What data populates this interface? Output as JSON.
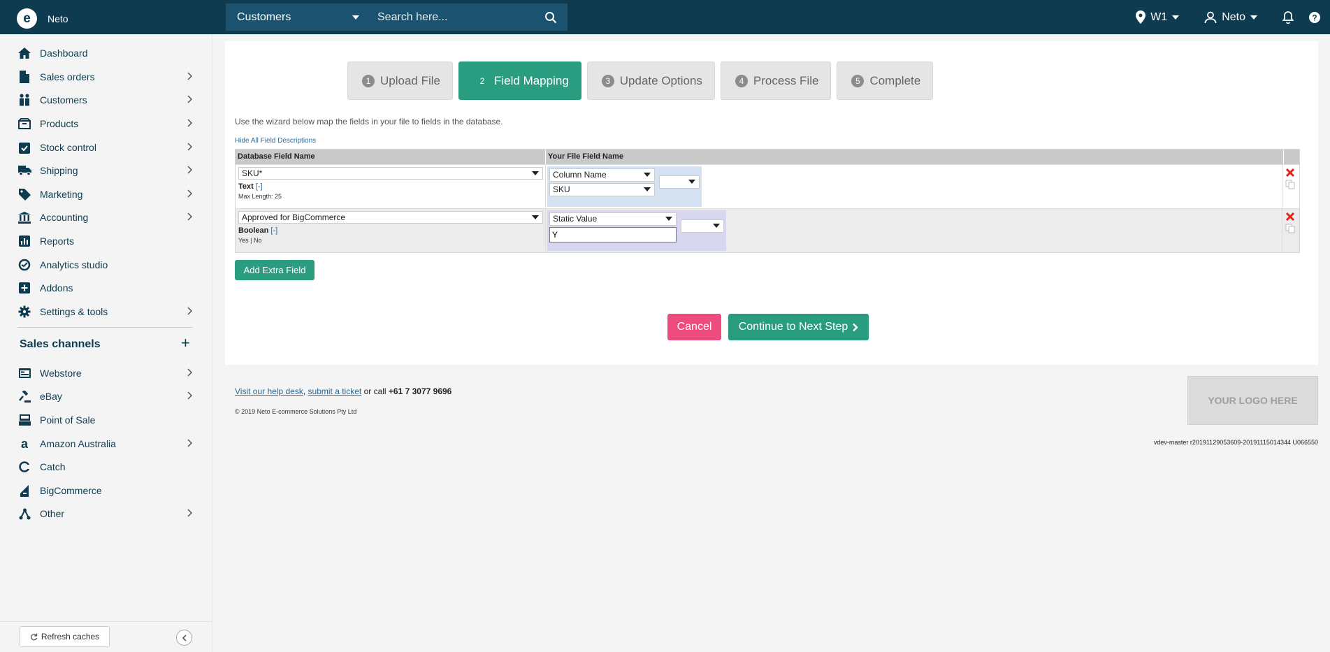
{
  "topbar": {
    "brand_logo": "e",
    "brand_name": "Neto",
    "search_scope": "Customers",
    "search_placeholder": "Search here...",
    "location": "W1",
    "user": "Neto"
  },
  "sidebar": {
    "items": [
      {
        "label": "Dashboard",
        "icon": "home-icon"
      },
      {
        "label": "Sales orders",
        "icon": "file-icon"
      },
      {
        "label": "Customers",
        "icon": "people-icon"
      },
      {
        "label": "Products",
        "icon": "box-icon"
      },
      {
        "label": "Stock control",
        "icon": "clipboard-check-icon"
      },
      {
        "label": "Shipping",
        "icon": "truck-icon"
      },
      {
        "label": "Marketing",
        "icon": "tag-icon"
      },
      {
        "label": "Accounting",
        "icon": "bank-icon"
      },
      {
        "label": "Reports",
        "icon": "bar-chart-icon"
      },
      {
        "label": "Analytics studio",
        "icon": "analytics-icon"
      },
      {
        "label": "Addons",
        "icon": "plus-square-icon"
      },
      {
        "label": "Settings & tools",
        "icon": "gear-icon"
      }
    ],
    "sales_channels_title": "Sales channels",
    "channels": [
      {
        "label": "Webstore",
        "icon": "webstore-icon"
      },
      {
        "label": "eBay",
        "icon": "gavel-icon"
      },
      {
        "label": "Point of Sale",
        "icon": "pos-icon"
      },
      {
        "label": "Amazon Australia",
        "icon": "amazon-icon"
      },
      {
        "label": "Catch",
        "icon": "catch-icon"
      },
      {
        "label": "BigCommerce",
        "icon": "bigcommerce-icon"
      },
      {
        "label": "Other",
        "icon": "nodes-icon"
      }
    ],
    "refresh_label": "Refresh caches"
  },
  "wizard": {
    "steps": [
      {
        "num": "1",
        "label": "Upload File"
      },
      {
        "num": "2",
        "label": "Field Mapping"
      },
      {
        "num": "3",
        "label": "Update Options"
      },
      {
        "num": "4",
        "label": "Process File"
      },
      {
        "num": "5",
        "label": "Complete"
      }
    ],
    "intro": "Use the wizard below map the fields in your file to fields in the database.",
    "hide_descriptions": "Hide All Field Descriptions",
    "col_db": "Database Field Name",
    "col_file": "Your File Field Name",
    "rows": [
      {
        "db_field": "SKU*",
        "type": "Text",
        "toggle": "[-]",
        "desc": "Max Length: 25",
        "source_type": "Column Name",
        "source_value": "SKU",
        "extra": ""
      },
      {
        "db_field": "Approved for BigCommerce",
        "type": "Boolean",
        "toggle": "[-]",
        "desc": "Yes | No",
        "source_type": "Static Value",
        "source_value": "Y",
        "extra": ""
      }
    ],
    "add_extra": "Add Extra Field",
    "cancel": "Cancel",
    "next": "Continue to Next Step"
  },
  "footer": {
    "help_link": "Visit our help desk",
    "comma": ",",
    "ticket_link": "submit a ticket",
    "call_text": " or call ",
    "phone": "+61 7 3077 9696",
    "copyright": "© 2019 Neto E-commerce Solutions Pty Ltd",
    "logo_placeholder": "YOUR LOGO HERE",
    "version": "vdev-master r20191129053609-20191115014344 U066550"
  },
  "colors": {
    "topbar": "#0f3b50",
    "accent": "#2a9d80",
    "cancel": "#ee4b7f"
  }
}
